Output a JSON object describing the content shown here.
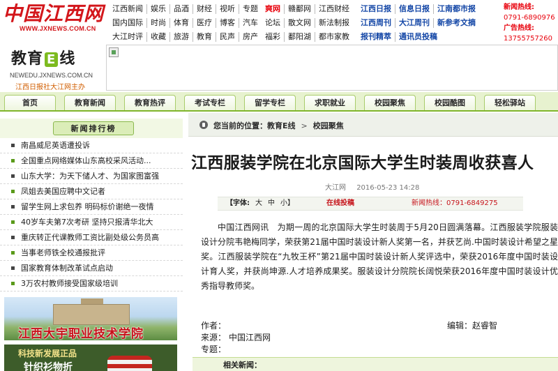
{
  "site": {
    "logo_text": "中国江西网",
    "logo_url": "WWW.JXNEWS.COM.CN"
  },
  "top_nav": {
    "rows": [
      {
        "group1": [
          "江西新闻",
          "娱乐",
          "品酒",
          "财经",
          "视听",
          "专题"
        ],
        "group2": [
          "爽网",
          "赣鄱网",
          "江西财经"
        ],
        "group3": [
          "江西日报",
          "信息日报",
          "江南都市报"
        ]
      },
      {
        "group1": [
          "国内国际",
          "时尚",
          "体育",
          "医疗",
          "博客",
          "汽车"
        ],
        "group2": [
          "论坛",
          "散文网",
          "新法制报"
        ],
        "group3": [
          "江西周刊",
          "大江周刊",
          "新参考文摘"
        ]
      },
      {
        "group1": [
          "大江时评",
          "收藏",
          "旅游",
          "教育",
          "民声",
          "房产"
        ],
        "group2": [
          "福彩",
          "鄱阳湖",
          "都市家教"
        ],
        "group3": [
          "报刊精萃",
          "通讯员投稿"
        ]
      }
    ]
  },
  "hotline": {
    "news_label": "新闻热线:",
    "news_number": "0791-6890976",
    "ad_label": "广告热线:",
    "ad_number": "13755757260"
  },
  "section_logo": {
    "left": "教育",
    "badge": "E",
    "right": "线",
    "url": "NEWEDU.JXNEWS.COM.CN",
    "host": "江西日报社大江网主办"
  },
  "section_nav": [
    "首页",
    "教育新闻",
    "教育热评",
    "考试专栏",
    "留学专栏",
    "求职就业",
    "校园聚焦",
    "校园酷图",
    "轻松驿站"
  ],
  "sidebar": {
    "rank_title": "新闻排行榜",
    "items": [
      "南昌威尼英语遭投诉",
      "全国重点网络媒体山东高校采风活动...",
      "山东大学：为天下储人才、为国家图富强",
      "凤姐去美国应聘中文记者",
      "留学生网上求包养 明码标价谢绝一夜情",
      "40岁车夫第7次考研 坚持只报清华北大",
      "重庆转正代课教师工资比副处级公务员高",
      "当事老师铁全校通报批评",
      "国家教育体制改革试点启动",
      "3万农村教师接受国家级培训"
    ],
    "ad_univ": "江西大宇职业技术学院",
    "ad_brand_top": "科技新发展正品",
    "ad_brand_bottom": "针织衫物折"
  },
  "breadcrumb": {
    "label": "您当前的位置：",
    "parts": [
      "教育E线",
      "校园聚焦"
    ]
  },
  "article": {
    "title": "江西服装学院在北京国际大学生时装周收获喜人",
    "source": "大江网",
    "datetime": "2016-05-23 14:28",
    "tools": {
      "font_label": "【字体:",
      "large": "大",
      "medium": "中",
      "small": "小】",
      "contribute": "在线投稿",
      "hotline": "新闻热线：0791-6849275"
    },
    "body": "中国江西网讯　为期一周的北京国际大学生时装周于5月20日圆满落幕。江西服装学院服装设计分院韦艳梅同学，荣获第21届中国时装设计新人奖第一名，并获艺尚.中国时装设计希望之星奖。江西服装学院在“九牧王杯”第21届中国时装设计新人奖评选中，荣获2016年度中国时装设计育人奖，并获尚坤源.人才培养成果奖。服装设计分院院长阔悦荣获2016年度中国时装设计优秀指导教师奖。",
    "author_label": "作者：",
    "author": "",
    "source_label": "来源：",
    "source_value": "中国江西网",
    "topic_label": "专题：",
    "topic": "",
    "editor_label": "编辑：",
    "editor": "赵睿智",
    "related": "相关新闻："
  }
}
